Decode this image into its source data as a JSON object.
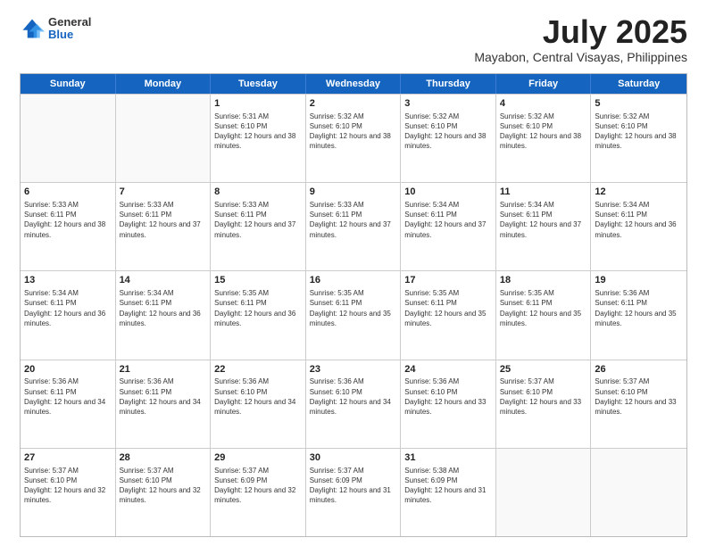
{
  "header": {
    "logo": {
      "general": "General",
      "blue": "Blue"
    },
    "title": "July 2025",
    "subtitle": "Mayabon, Central Visayas, Philippines"
  },
  "calendar": {
    "days": [
      "Sunday",
      "Monday",
      "Tuesday",
      "Wednesday",
      "Thursday",
      "Friday",
      "Saturday"
    ],
    "rows": [
      [
        {
          "day": "",
          "empty": true
        },
        {
          "day": "",
          "empty": true
        },
        {
          "day": "1",
          "sunrise": "Sunrise: 5:31 AM",
          "sunset": "Sunset: 6:10 PM",
          "daylight": "Daylight: 12 hours and 38 minutes."
        },
        {
          "day": "2",
          "sunrise": "Sunrise: 5:32 AM",
          "sunset": "Sunset: 6:10 PM",
          "daylight": "Daylight: 12 hours and 38 minutes."
        },
        {
          "day": "3",
          "sunrise": "Sunrise: 5:32 AM",
          "sunset": "Sunset: 6:10 PM",
          "daylight": "Daylight: 12 hours and 38 minutes."
        },
        {
          "day": "4",
          "sunrise": "Sunrise: 5:32 AM",
          "sunset": "Sunset: 6:10 PM",
          "daylight": "Daylight: 12 hours and 38 minutes."
        },
        {
          "day": "5",
          "sunrise": "Sunrise: 5:32 AM",
          "sunset": "Sunset: 6:10 PM",
          "daylight": "Daylight: 12 hours and 38 minutes."
        }
      ],
      [
        {
          "day": "6",
          "sunrise": "Sunrise: 5:33 AM",
          "sunset": "Sunset: 6:11 PM",
          "daylight": "Daylight: 12 hours and 38 minutes."
        },
        {
          "day": "7",
          "sunrise": "Sunrise: 5:33 AM",
          "sunset": "Sunset: 6:11 PM",
          "daylight": "Daylight: 12 hours and 37 minutes."
        },
        {
          "day": "8",
          "sunrise": "Sunrise: 5:33 AM",
          "sunset": "Sunset: 6:11 PM",
          "daylight": "Daylight: 12 hours and 37 minutes."
        },
        {
          "day": "9",
          "sunrise": "Sunrise: 5:33 AM",
          "sunset": "Sunset: 6:11 PM",
          "daylight": "Daylight: 12 hours and 37 minutes."
        },
        {
          "day": "10",
          "sunrise": "Sunrise: 5:34 AM",
          "sunset": "Sunset: 6:11 PM",
          "daylight": "Daylight: 12 hours and 37 minutes."
        },
        {
          "day": "11",
          "sunrise": "Sunrise: 5:34 AM",
          "sunset": "Sunset: 6:11 PM",
          "daylight": "Daylight: 12 hours and 37 minutes."
        },
        {
          "day": "12",
          "sunrise": "Sunrise: 5:34 AM",
          "sunset": "Sunset: 6:11 PM",
          "daylight": "Daylight: 12 hours and 36 minutes."
        }
      ],
      [
        {
          "day": "13",
          "sunrise": "Sunrise: 5:34 AM",
          "sunset": "Sunset: 6:11 PM",
          "daylight": "Daylight: 12 hours and 36 minutes."
        },
        {
          "day": "14",
          "sunrise": "Sunrise: 5:34 AM",
          "sunset": "Sunset: 6:11 PM",
          "daylight": "Daylight: 12 hours and 36 minutes."
        },
        {
          "day": "15",
          "sunrise": "Sunrise: 5:35 AM",
          "sunset": "Sunset: 6:11 PM",
          "daylight": "Daylight: 12 hours and 36 minutes."
        },
        {
          "day": "16",
          "sunrise": "Sunrise: 5:35 AM",
          "sunset": "Sunset: 6:11 PM",
          "daylight": "Daylight: 12 hours and 35 minutes."
        },
        {
          "day": "17",
          "sunrise": "Sunrise: 5:35 AM",
          "sunset": "Sunset: 6:11 PM",
          "daylight": "Daylight: 12 hours and 35 minutes."
        },
        {
          "day": "18",
          "sunrise": "Sunrise: 5:35 AM",
          "sunset": "Sunset: 6:11 PM",
          "daylight": "Daylight: 12 hours and 35 minutes."
        },
        {
          "day": "19",
          "sunrise": "Sunrise: 5:36 AM",
          "sunset": "Sunset: 6:11 PM",
          "daylight": "Daylight: 12 hours and 35 minutes."
        }
      ],
      [
        {
          "day": "20",
          "sunrise": "Sunrise: 5:36 AM",
          "sunset": "Sunset: 6:11 PM",
          "daylight": "Daylight: 12 hours and 34 minutes."
        },
        {
          "day": "21",
          "sunrise": "Sunrise: 5:36 AM",
          "sunset": "Sunset: 6:11 PM",
          "daylight": "Daylight: 12 hours and 34 minutes."
        },
        {
          "day": "22",
          "sunrise": "Sunrise: 5:36 AM",
          "sunset": "Sunset: 6:10 PM",
          "daylight": "Daylight: 12 hours and 34 minutes."
        },
        {
          "day": "23",
          "sunrise": "Sunrise: 5:36 AM",
          "sunset": "Sunset: 6:10 PM",
          "daylight": "Daylight: 12 hours and 34 minutes."
        },
        {
          "day": "24",
          "sunrise": "Sunrise: 5:36 AM",
          "sunset": "Sunset: 6:10 PM",
          "daylight": "Daylight: 12 hours and 33 minutes."
        },
        {
          "day": "25",
          "sunrise": "Sunrise: 5:37 AM",
          "sunset": "Sunset: 6:10 PM",
          "daylight": "Daylight: 12 hours and 33 minutes."
        },
        {
          "day": "26",
          "sunrise": "Sunrise: 5:37 AM",
          "sunset": "Sunset: 6:10 PM",
          "daylight": "Daylight: 12 hours and 33 minutes."
        }
      ],
      [
        {
          "day": "27",
          "sunrise": "Sunrise: 5:37 AM",
          "sunset": "Sunset: 6:10 PM",
          "daylight": "Daylight: 12 hours and 32 minutes."
        },
        {
          "day": "28",
          "sunrise": "Sunrise: 5:37 AM",
          "sunset": "Sunset: 6:10 PM",
          "daylight": "Daylight: 12 hours and 32 minutes."
        },
        {
          "day": "29",
          "sunrise": "Sunrise: 5:37 AM",
          "sunset": "Sunset: 6:09 PM",
          "daylight": "Daylight: 12 hours and 32 minutes."
        },
        {
          "day": "30",
          "sunrise": "Sunrise: 5:37 AM",
          "sunset": "Sunset: 6:09 PM",
          "daylight": "Daylight: 12 hours and 31 minutes."
        },
        {
          "day": "31",
          "sunrise": "Sunrise: 5:38 AM",
          "sunset": "Sunset: 6:09 PM",
          "daylight": "Daylight: 12 hours and 31 minutes."
        },
        {
          "day": "",
          "empty": true
        },
        {
          "day": "",
          "empty": true
        }
      ]
    ]
  }
}
